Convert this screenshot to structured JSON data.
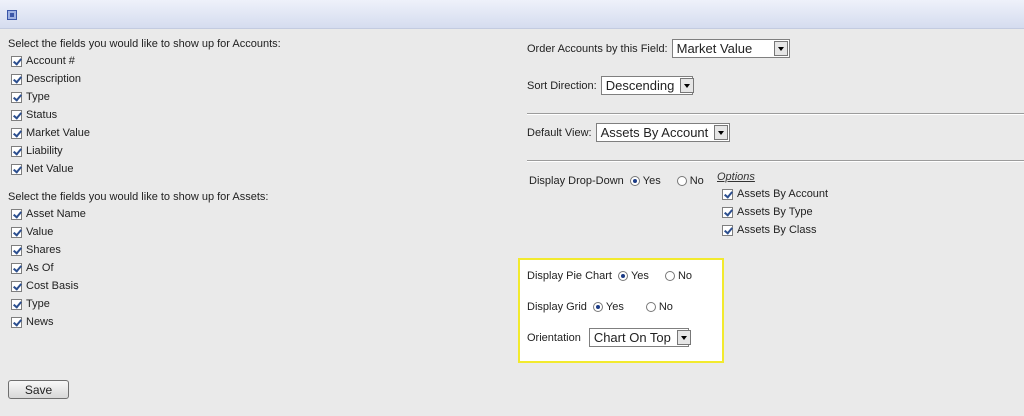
{
  "accounts": {
    "heading": "Select the fields you would like to show up for Accounts:",
    "fields": [
      "Account #",
      "Description",
      "Type",
      "Status",
      "Market Value",
      "Liability",
      "Net Value"
    ]
  },
  "assets": {
    "heading": "Select the fields you would like to show up for Assets:",
    "fields": [
      "Asset Name",
      "Value",
      "Shares",
      "As Of",
      "Cost Basis",
      "Type",
      "News"
    ]
  },
  "order": {
    "label": "Order Accounts by this Field:",
    "value": "Market Value"
  },
  "sort": {
    "label": "Sort Direction:",
    "value": "Descending"
  },
  "default_view": {
    "label": "Default View:",
    "value": "Assets By Account"
  },
  "dropdown": {
    "label": "Display Drop-Down",
    "yes": "Yes",
    "no": "No",
    "selected": "Yes"
  },
  "options": {
    "title": "Options",
    "items": [
      "Assets By Account",
      "Assets By Type",
      "Assets By Class"
    ]
  },
  "pie_chart": {
    "label": "Display Pie Chart",
    "yes": "Yes",
    "no": "No",
    "selected": "Yes"
  },
  "grid": {
    "label": "Display Grid",
    "yes": "Yes",
    "no": "No",
    "selected": "Yes"
  },
  "orientation": {
    "label": "Orientation",
    "value": "Chart On Top"
  },
  "save_label": "Save"
}
